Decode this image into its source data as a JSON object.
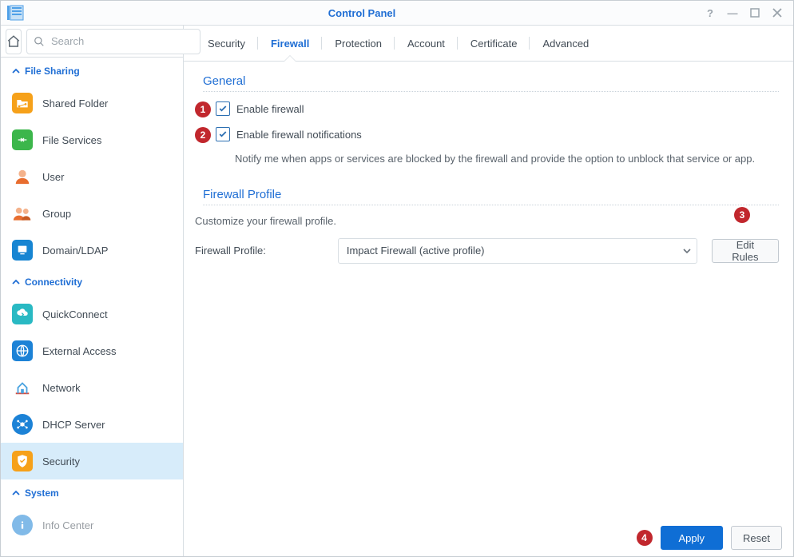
{
  "window": {
    "title": "Control Panel"
  },
  "search": {
    "placeholder": "Search"
  },
  "groups": {
    "fileSharing": "File Sharing",
    "connectivity": "Connectivity",
    "system": "System"
  },
  "nav": {
    "sharedFolder": "Shared Folder",
    "fileServices": "File Services",
    "user": "User",
    "group": "Group",
    "domain": "Domain/LDAP",
    "quickConnect": "QuickConnect",
    "externalAccess": "External Access",
    "network": "Network",
    "dhcp": "DHCP Server",
    "security": "Security",
    "infoCenter": "Info Center"
  },
  "tabs": {
    "security": "Security",
    "firewall": "Firewall",
    "protection": "Protection",
    "account": "Account",
    "certificate": "Certificate",
    "advanced": "Advanced"
  },
  "general": {
    "title": "General",
    "enableFirewall": "Enable firewall",
    "enableNotifications": "Enable firewall notifications",
    "note": "Notify me when apps or services are blocked by the firewall and provide the option to unblock that service or app."
  },
  "profile": {
    "title": "Firewall Profile",
    "desc": "Customize your firewall profile.",
    "label": "Firewall Profile:",
    "selected": "Impact Firewall (active profile)",
    "editBtn": "Edit Rules"
  },
  "buttons": {
    "apply": "Apply",
    "reset": "Reset"
  },
  "callouts": {
    "c1": "1",
    "c2": "2",
    "c3": "3",
    "c4": "4"
  }
}
